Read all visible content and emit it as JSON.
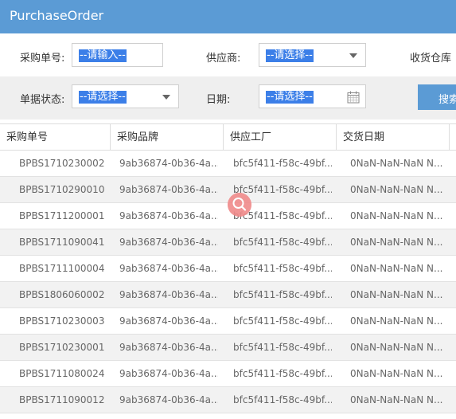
{
  "window": {
    "title": "PurchaseOrder"
  },
  "filters": {
    "po_no": {
      "label": "采购单号:",
      "value": "--请输入--"
    },
    "supplier": {
      "label": "供应商:",
      "value": "--请选择--"
    },
    "warehouse": {
      "label": "收货仓库"
    },
    "status": {
      "label": "单据状态:",
      "value": "--请选择--"
    },
    "date": {
      "label": "日期:",
      "value": "--请选择--"
    },
    "search_label": "搜索"
  },
  "table": {
    "headers": [
      "采购单号",
      "采购品牌",
      "供应工厂",
      "交货日期"
    ],
    "rows": [
      [
        "BPBS1710230002",
        "9ab36874-0b36-4a...",
        "bfc5f411-f58c-49bf...",
        "0NaN-NaN-NaN N..."
      ],
      [
        "BPBS1710290010",
        "9ab36874-0b36-4a...",
        "bfc5f411-f58c-49bf...",
        "0NaN-NaN-NaN N..."
      ],
      [
        "BPBS1711200001",
        "9ab36874-0b36-4a...",
        "bfc5f411-f58c-49bf...",
        "0NaN-NaN-NaN N..."
      ],
      [
        "BPBS1711090041",
        "9ab36874-0b36-4a...",
        "bfc5f411-f58c-49bf...",
        "0NaN-NaN-NaN N..."
      ],
      [
        "BPBS1711100004",
        "9ab36874-0b36-4a...",
        "bfc5f411-f58c-49bf...",
        "0NaN-NaN-NaN N..."
      ],
      [
        "BPBS1806060002",
        "9ab36874-0b36-4a...",
        "bfc5f411-f58c-49bf...",
        "0NaN-NaN-NaN N..."
      ],
      [
        "BPBS1710230003",
        "9ab36874-0b36-4a...",
        "bfc5f411-f58c-49bf...",
        "0NaN-NaN-NaN N..."
      ],
      [
        "BPBS1710230001",
        "9ab36874-0b36-4a...",
        "bfc5f411-f58c-49bf...",
        "0NaN-NaN-NaN N..."
      ],
      [
        "BPBS1711080024",
        "9ab36874-0b36-4a...",
        "bfc5f411-f58c-49bf...",
        "0NaN-NaN-NaN N..."
      ],
      [
        "BPBS1711090012",
        "9ab36874-0b36-4a...",
        "bfc5f411-f58c-49bf...",
        "0NaN-NaN-NaN N..."
      ]
    ]
  },
  "colors": {
    "accent": "#5b9bd5",
    "selection": "#3c7fe8",
    "alt_row": "#f2f2f2"
  },
  "icons": {
    "caret": "chevron-down-icon",
    "calendar": "calendar-icon",
    "zoom": "search-icon"
  }
}
